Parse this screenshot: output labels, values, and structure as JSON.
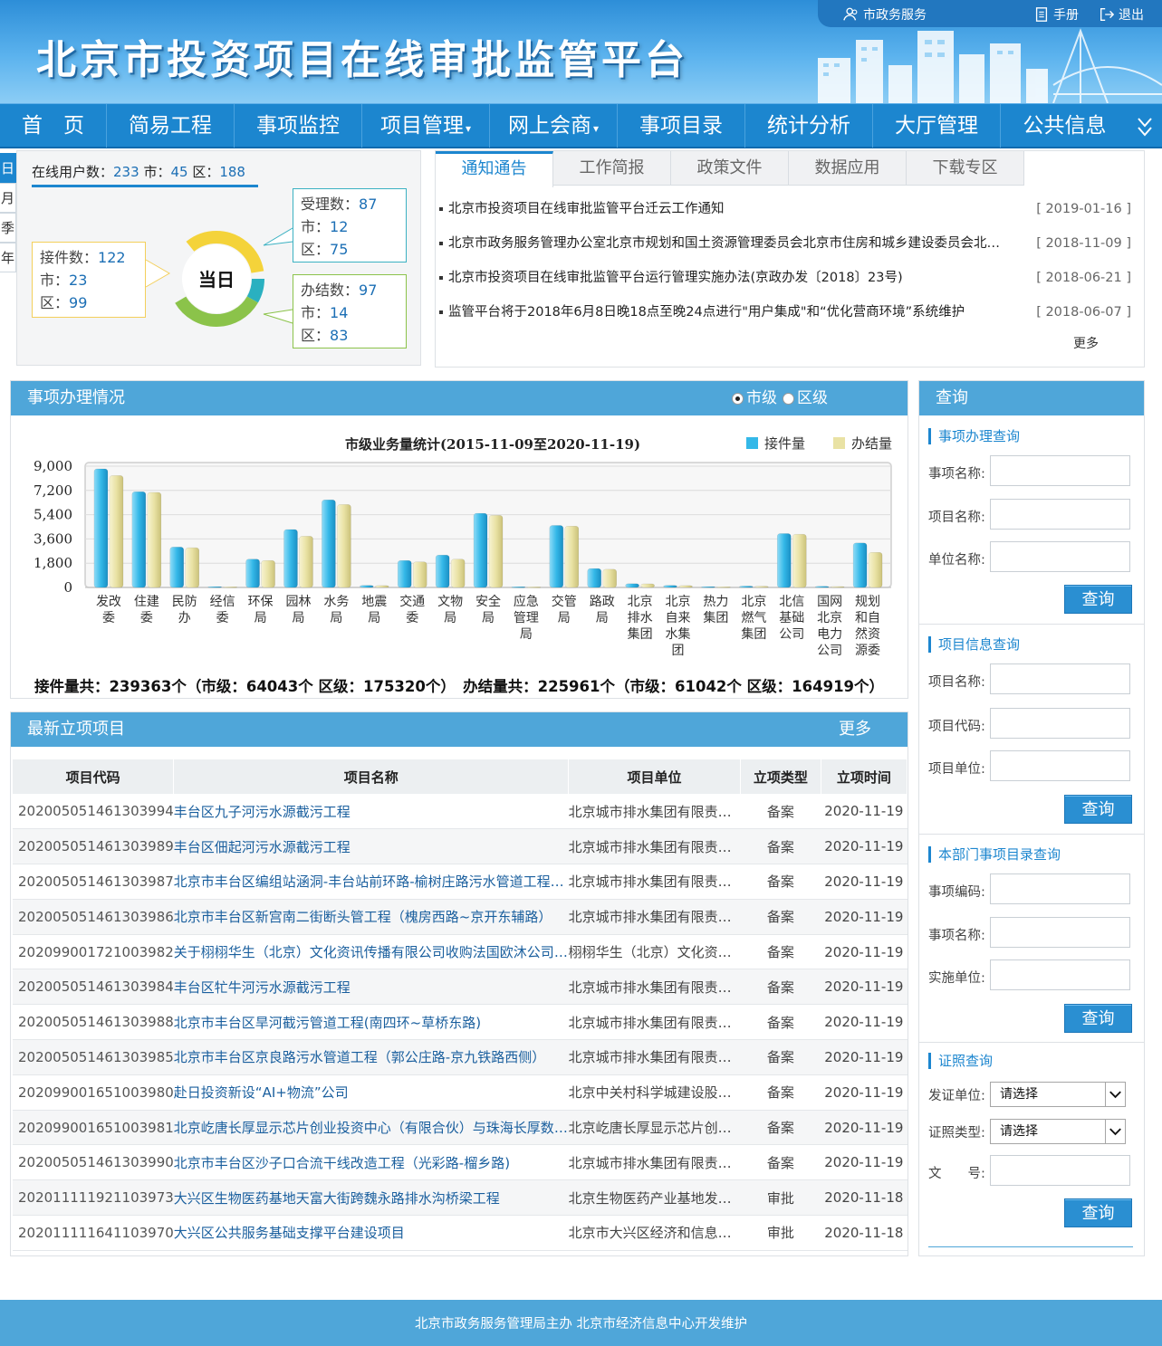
{
  "header": {
    "title": "北京市投资项目在线审批监管平台",
    "links": {
      "gov_service": "市政务服务",
      "manual": "手册",
      "logout": "退出"
    }
  },
  "nav": {
    "items": [
      {
        "label": "首　页"
      },
      {
        "label": "简易工程"
      },
      {
        "label": "事项监控"
      },
      {
        "label": "项目管理",
        "caret": "▾"
      },
      {
        "label": "网上会商",
        "caret": "▾"
      },
      {
        "label": "事项目录"
      },
      {
        "label": "统计分析"
      },
      {
        "label": "大厅管理"
      },
      {
        "label": "公共信息"
      }
    ]
  },
  "period_tabs": [
    "日",
    "月",
    "季",
    "年"
  ],
  "stats": {
    "online_label": "在线用户数：",
    "online_total": "233",
    "city_label": "市：",
    "online_city": "45",
    "district_label": "区：",
    "online_district": "188",
    "center_label": "当日",
    "received": {
      "label": "接件数：",
      "total": "122",
      "city": "23",
      "district": "99"
    },
    "accepted": {
      "label": "受理数：",
      "total": "87",
      "city": "12",
      "district": "75"
    },
    "completed": {
      "label": "办结数：",
      "total": "97",
      "city": "14",
      "district": "83"
    }
  },
  "notice": {
    "tabs": [
      "通知通告",
      "工作简报",
      "政策文件",
      "数据应用",
      "下载专区"
    ],
    "items": [
      {
        "title": "北京市投资项目在线审批监管平台迁云工作通知",
        "date": "[ 2019-01-16 ]"
      },
      {
        "title": "北京市政务服务管理办公室北京市规划和国土资源管理委员会北京市住房和城乡建设委员会北京市发展和改革委员会关于印发",
        "date": "[ 2018-11-09 ]"
      },
      {
        "title": "北京市投资项目在线审批监管平台运行管理实施办法(京政办发〔2018〕23号)",
        "date": "[ 2018-06-21 ]"
      },
      {
        "title": "监管平台将于2018年6月8日晚18点至晚24点进行\"用户集成\"和“优化营商环境”系统维护",
        "date": "[ 2018-06-07 ]"
      }
    ],
    "more": "更多"
  },
  "items_panel": {
    "title": "事项办理情况",
    "radio_city": "市级",
    "radio_district": "区级",
    "totals": "接件量共：239363个（市级：64043个 区级：175320个）　办结量共：225961个（市级：61042个 区级：164919个）"
  },
  "chart_data": {
    "type": "bar",
    "title": "市级业务量统计(2015-11-09至2020-11-19)",
    "categories": [
      "发改委",
      "住建委",
      "民防办",
      "经信委",
      "环保局",
      "园林局",
      "水务局",
      "地震局",
      "交通委",
      "文物局",
      "安全局",
      "应急管理局",
      "交管局",
      "路政局",
      "北京排水集团",
      "北京自来水集团",
      "热力集团",
      "北京燃气集团",
      "北信基础公司",
      "国网北京电力公司",
      "规划和自然资源委"
    ],
    "category_lines": [
      [
        "发改",
        "委"
      ],
      [
        "住建",
        "委"
      ],
      [
        "民防",
        "办"
      ],
      [
        "经信",
        "委"
      ],
      [
        "环保",
        "局"
      ],
      [
        "园林",
        "局"
      ],
      [
        "水务",
        "局"
      ],
      [
        "地震",
        "局"
      ],
      [
        "交通",
        "委"
      ],
      [
        "文物",
        "局"
      ],
      [
        "安全",
        "局"
      ],
      [
        "应急",
        "管理",
        "局"
      ],
      [
        "交管",
        "局"
      ],
      [
        "路政",
        "局"
      ],
      [
        "北京",
        "排水",
        "集团"
      ],
      [
        "北京",
        "自来",
        "水集",
        "团"
      ],
      [
        "热力",
        "集团"
      ],
      [
        "北京",
        "燃气",
        "集团"
      ],
      [
        "北信",
        "基础",
        "公司"
      ],
      [
        "国网",
        "北京",
        "电力",
        "公司"
      ],
      [
        "规划",
        "和自",
        "然资",
        "源委"
      ]
    ],
    "series": [
      {
        "name": "接件量",
        "color": "#34b8e8",
        "values": [
          8800,
          7100,
          3000,
          60,
          2100,
          4300,
          6500,
          150,
          2000,
          2400,
          5500,
          50,
          4600,
          1400,
          280,
          150,
          60,
          100,
          4000,
          80,
          3300
        ]
      },
      {
        "name": "办结量",
        "color": "#e9e2a4",
        "values": [
          8300,
          7050,
          2950,
          50,
          2000,
          3800,
          6150,
          140,
          1900,
          2100,
          5350,
          40,
          4550,
          1350,
          270,
          140,
          50,
          90,
          3950,
          70,
          2600
        ]
      }
    ],
    "yticks": [
      "0",
      "1,800",
      "3,600",
      "5,400",
      "7,200",
      "9,000"
    ],
    "ylim": [
      0,
      9000
    ],
    "grid": true,
    "legend": "top-right"
  },
  "projects": {
    "title": "最新立项项目",
    "more": "更多",
    "columns": [
      "项目代码",
      "项目名称",
      "项目单位",
      "立项类型",
      "立项时间"
    ],
    "rows": [
      [
        "202005051461303994",
        "丰台区九子河污水源截污工程",
        "北京城市排水集团有限责任公司",
        "备案",
        "2020-11-19"
      ],
      [
        "202005051461303989",
        "丰台区佃起河污水源截污工程",
        "北京城市排水集团有限责任公司",
        "备案",
        "2020-11-19"
      ],
      [
        "202005051461303987",
        "北京市丰台区编组站涵洞-丰台站前环路-榆树庄路污水管道工程项目",
        "北京城市排水集团有限责任公司",
        "备案",
        "2020-11-19"
      ],
      [
        "202005051461303986",
        "北京市丰台区新宫南二街断头管工程（槐房西路~京开东辅路）",
        "北京城市排水集团有限责任公司",
        "备案",
        "2020-11-19"
      ],
      [
        "202099001721003982",
        "关于栩栩华生（北京）文化资讯传播有限公司收购法国欧沐公司项目",
        "栩栩华生（北京）文化资讯传播有限公司",
        "备案",
        "2020-11-19"
      ],
      [
        "202005051461303984",
        "丰台区牤牛河污水源截污工程",
        "北京城市排水集团有限责任公司",
        "备案",
        "2020-11-19"
      ],
      [
        "202005051461303988",
        "北京市丰台区旱河截污管道工程(南四环~草桥东路)",
        "北京城市排水集团有限责任公司",
        "备案",
        "2020-11-19"
      ],
      [
        "202005051461303985",
        "北京市丰台区京良路污水管道工程（郭公庄路-京九铁路西侧）",
        "北京城市排水集团有限责任公司",
        "备案",
        "2020-11-19"
      ],
      [
        "202099001651003980",
        "赴日投资新设“AI+物流”公司",
        "北京中关村科学城建设股份有限公司",
        "备案",
        "2020-11-19"
      ],
      [
        "202099001651003981",
        "北京屹唐长厚显示芯片创业投资中心（有限合伙）与珠海长厚数码科技有限公司",
        "北京屹唐长厚显示芯片创业投资中心",
        "备案",
        "2020-11-19"
      ],
      [
        "202005051461303990",
        "北京市丰台区沙子口合流干线改造工程（光彩路-榴乡路)",
        "北京城市排水集团有限责任公司",
        "备案",
        "2020-11-19"
      ],
      [
        "202011111921103973",
        "大兴区生物医药基地天富大街跨魏永路排水沟桥梁工程",
        "北京生物医药产业基地发展有限公司",
        "审批",
        "2020-11-18"
      ],
      [
        "202011111641103970",
        "大兴区公共服务基础支撑平台建设项目",
        "北京市大兴区经济和信息化局",
        "审批",
        "2020-11-18"
      ]
    ]
  },
  "query": {
    "title": "查询",
    "button": "查询",
    "groups": [
      {
        "title": "事项办理查询",
        "fields": [
          "事项名称:",
          "项目名称:",
          "单位名称:"
        ]
      },
      {
        "title": "项目信息查询",
        "fields": [
          "项目名称:",
          "项目代码:",
          "项目单位:"
        ]
      },
      {
        "title": "本部门事项目录查询",
        "fields": [
          "事项编码:",
          "事项名称:",
          "实施单位:"
        ]
      }
    ],
    "cert": {
      "title": "证照查询",
      "issuer_label": "发证单位:",
      "issuer_value": "请选择",
      "type_label": "证照类型:",
      "type_value": "请选择",
      "doc_label": "文　　号:"
    }
  },
  "footer": {
    "text": "北京市政务服务管理局主办 北京市经济信息中心开发维护"
  },
  "colors": {
    "primary": "#1c86cf",
    "section_head": "#4fa6d9",
    "link": "#1a5f9e"
  }
}
